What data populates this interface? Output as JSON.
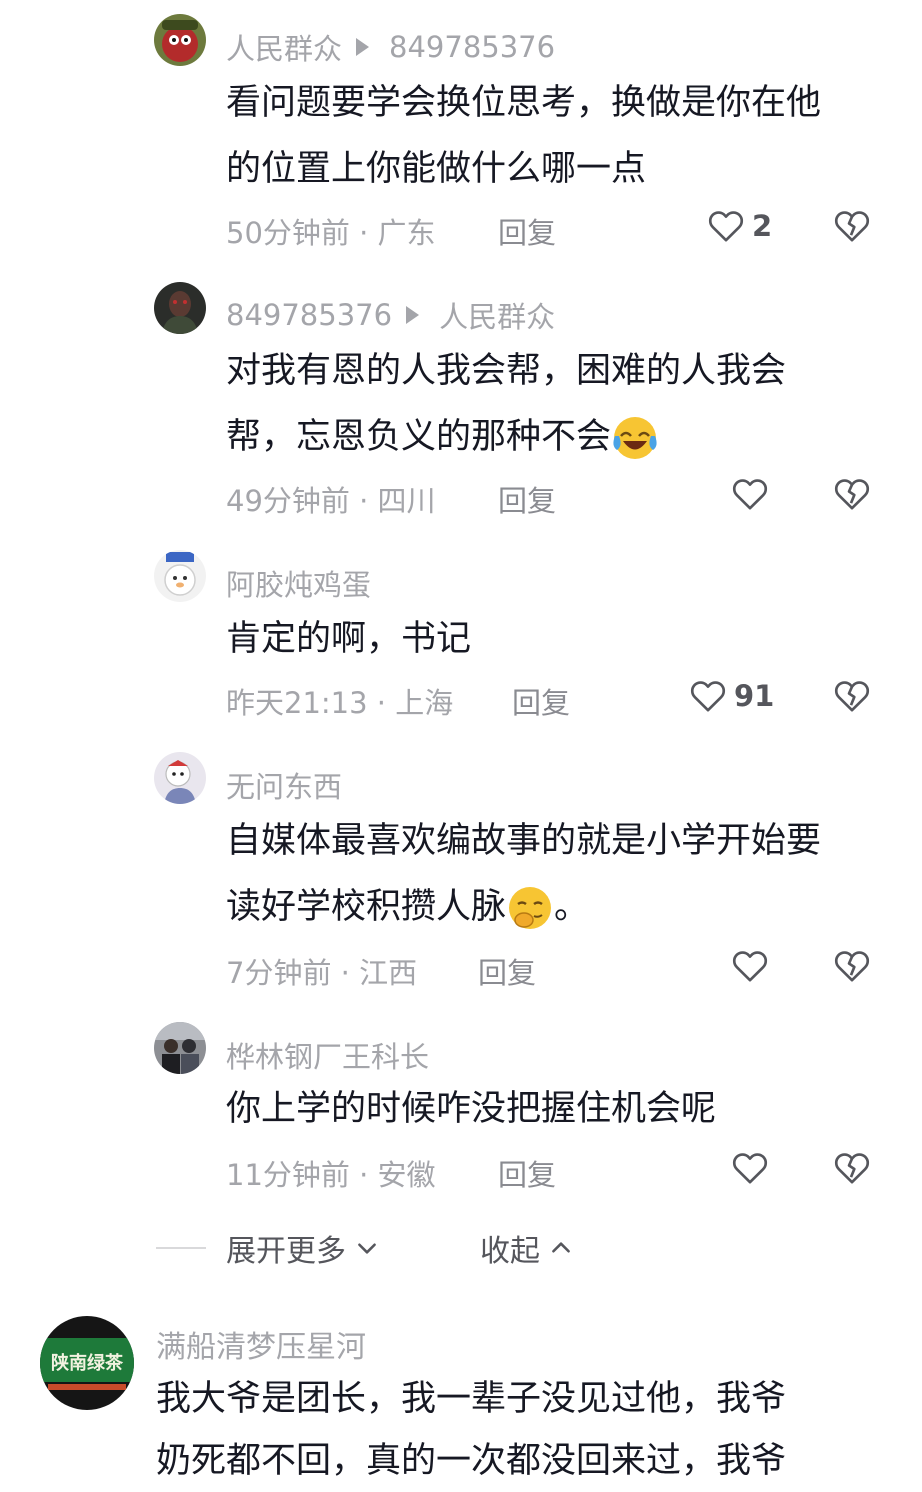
{
  "replies": [
    {
      "author": "人民群众",
      "reply_to": "849785376",
      "content_lines": [
        "看问题要学会换位思考，换做是你在他",
        "的位置上你能做什么哪一点"
      ],
      "time_location": "50分钟前 · 广东",
      "reply_label": "回复",
      "likes": "2",
      "avatar": "cartoon-avatar-icon"
    },
    {
      "author": "849785376",
      "reply_to": "人民群众",
      "content_lines": [
        "对我有恩的人我会帮，困难的人我会",
        "帮，忘恩负义的那种不会"
      ],
      "emoji": "laughing-crying-emoji-icon",
      "time_location": "49分钟前 · 四川",
      "reply_label": "回复",
      "likes": "",
      "avatar": "dark-figure-avatar-icon"
    },
    {
      "author": "阿胶炖鸡蛋",
      "reply_to": "",
      "content_lines": [
        "肯定的啊，书记"
      ],
      "time_location": "昨天21:13 · 上海",
      "reply_label": "回复",
      "likes": "91",
      "avatar": "white-cartoon-avatar-icon"
    },
    {
      "author": "无问东西",
      "reply_to": "",
      "content_lines": [
        "自媒体最喜欢编故事的就是小学开始要",
        "读好学校积攒人脉"
      ],
      "emoji": "smirk-emoji-icon",
      "content_tail": "。",
      "time_location": "7分钟前 · 江西",
      "reply_label": "回复",
      "likes": "",
      "avatar": "cartoon-character-avatar-icon"
    },
    {
      "author": "桦林钢厂王科长",
      "reply_to": "",
      "content_lines": [
        "你上学的时候咋没把握住机会呢"
      ],
      "time_location": "11分钟前 · 安徽",
      "reply_label": "回复",
      "likes": "",
      "avatar": "group-photo-avatar-icon"
    }
  ],
  "expand": {
    "more_label": "展开更多",
    "collapse_label": "收起"
  },
  "top_comment": {
    "author": "满船清梦压星河",
    "avatar_text": "陕南绿茶",
    "content_lines": [
      "我大爷是团长，我一辈子没见过他，我爷",
      "奶死都不回，真的一次都没回来过，我爷"
    ]
  },
  "colors": {
    "text": "#161823",
    "meta": "#a4a5aa",
    "accent_yellow": "#f7c533",
    "avatar_green": "#1e7a3a"
  }
}
